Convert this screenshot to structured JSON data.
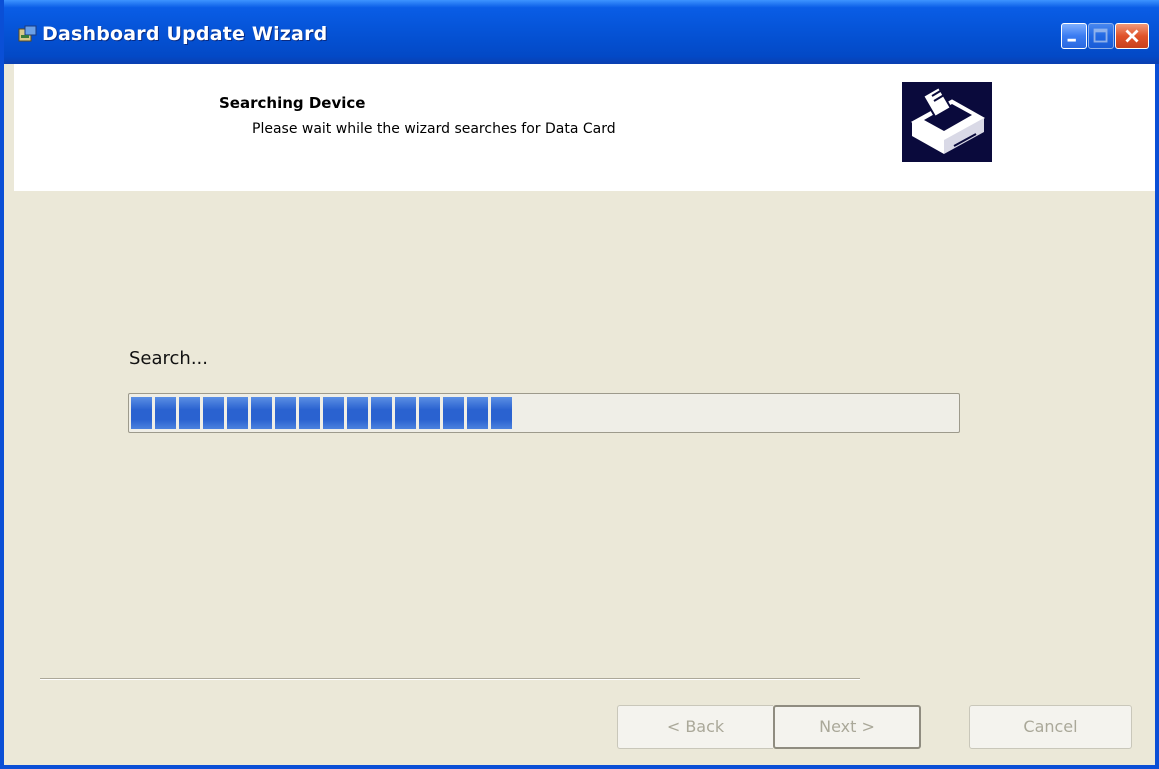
{
  "window": {
    "title": "Dashboard Update Wizard"
  },
  "header": {
    "title": "Searching Device",
    "subtitle": "Please wait while the wizard searches for Data Card"
  },
  "main": {
    "status_label": "Search...",
    "progress": {
      "filled_blocks": 16,
      "fraction": 0.47
    }
  },
  "buttons": {
    "back_label": "< Back",
    "next_label": "Next >",
    "cancel_label": "Cancel"
  },
  "colors": {
    "titlebar": "#0553d6",
    "window_bg": "#ebe8d8",
    "progress_block": "#2a62d0",
    "disabled_text": "#aaa899"
  },
  "icons": {
    "title": "wizard-app-icon",
    "header_graphic": "hardware-drive-icon",
    "minimize": "minimize-icon",
    "maximize": "maximize-icon",
    "close": "close-icon"
  }
}
